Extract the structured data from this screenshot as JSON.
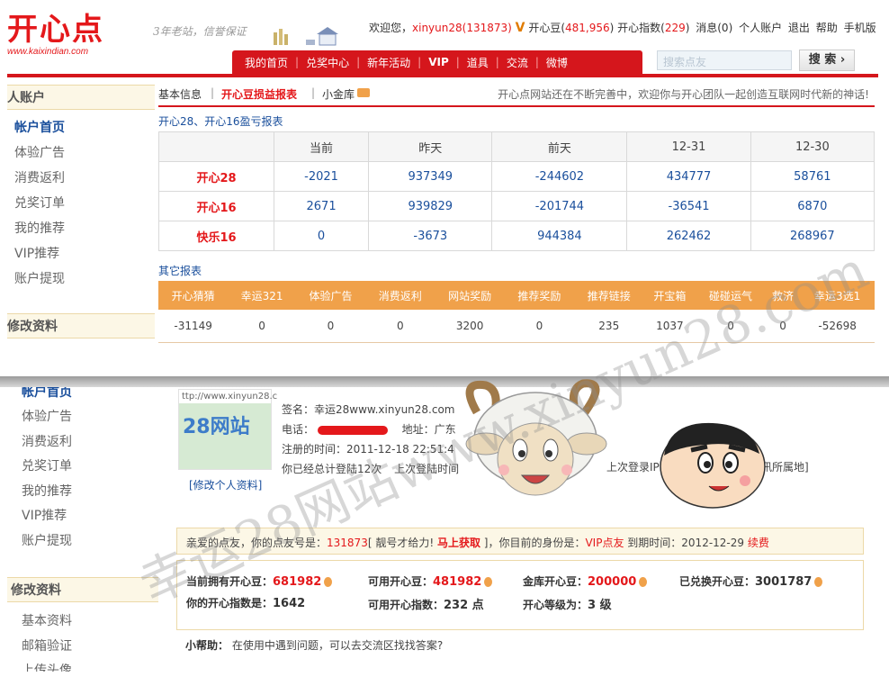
{
  "header": {
    "logo_text": "开心点",
    "logo_url": "www.kaixindian.com",
    "slogan": "3年老站，信誉保证",
    "welcome": "欢迎您，",
    "username": "xinyun28(131873)",
    "vip_mark": "V",
    "beans_label": "开心豆(",
    "beans_value": "481,956",
    "beans_close": ")",
    "index_label": "开心指数(",
    "index_value": "229",
    "index_close": ")",
    "links": [
      "消息(0)",
      "个人账户",
      "退出",
      "帮助",
      "手机版"
    ]
  },
  "nav": {
    "items": [
      "我的首页",
      "兑奖中心",
      "新年活动",
      "VIP",
      "道具",
      "交流",
      "微博"
    ]
  },
  "search": {
    "placeholder": "搜索点友",
    "button": "搜 索 ›"
  },
  "sidebar_top": {
    "heading": "人账户",
    "items": [
      "帐户首页",
      "体验广告",
      "消费返利",
      "兑奖订单",
      "我的推荐",
      "VIP推荐",
      "账户提现"
    ],
    "heading2": "修改资料"
  },
  "tabs": {
    "items": [
      "基本信息",
      "开心豆损益报表",
      "小金库"
    ],
    "notice": "开心点网站还在不断完善中，欢迎你与开心团队一起创造互联网时代新的神话!"
  },
  "report": {
    "title": "开心28、开心16盈亏报表",
    "columns": [
      "",
      "当前",
      "昨天",
      "前天",
      "12-31",
      "12-30"
    ],
    "rows": [
      {
        "name": "开心28",
        "values": [
          "-2021",
          "937349",
          "-244602",
          "434777",
          "58761"
        ]
      },
      {
        "name": "开心16",
        "values": [
          "2671",
          "939829",
          "-201744",
          "-36541",
          "6870"
        ]
      },
      {
        "name": "快乐16",
        "values": [
          "0",
          "-3673",
          "944384",
          "262462",
          "268967"
        ]
      }
    ]
  },
  "other_report": {
    "title": "其它报表",
    "columns": [
      "开心猜猜",
      "幸运321",
      "体验广告",
      "消费返利",
      "网站奖励",
      "推荐奖励",
      "推荐链接",
      "开宝箱",
      "碰碰运气",
      "救济",
      "幸运3选1"
    ],
    "values": [
      "-31149",
      "0",
      "0",
      "0",
      "3200",
      "0",
      "235",
      "1037",
      "0",
      "0",
      "-52698"
    ]
  },
  "sidebar_bottom": {
    "items": [
      "帐户首页",
      "体验广告",
      "消费返利",
      "兑奖订单",
      "我的推荐",
      "VIP推荐",
      "账户提现"
    ],
    "heading": "修改资料",
    "items2": [
      "基本资料",
      "邮箱验证",
      "上传头像"
    ]
  },
  "profile": {
    "avatar_url": "ttp://www.xinyun28.c",
    "avatar_text": "28网站",
    "edit_link": "[修改个人资料]",
    "signature": "签名：幸运28www.xinyun28.com",
    "phone_label": "电话：",
    "address_label": "地址：广东",
    "register_time": "注册的时间：2011-12-18 22:51:4",
    "login_count": "你已经总计登陆12次",
    "last_login_time": "上次登陆时间",
    "last_login_ip": "上次登录IP",
    "last_login_loc": "讯所属地]"
  },
  "status": {
    "greeting": "亲爱的点友，你的点友号是：",
    "user_id": "131873",
    "bracket_open": "[ 靓号才给力! ",
    "get_now": "马上获取",
    "bracket_close": " ]，你目前的身份是：",
    "identity": "VIP点友",
    "expiry_label": " 到期时间：2012-12-29 ",
    "renew": "续费"
  },
  "beans": {
    "current_label": "当前拥有开心豆：",
    "current_value": "681982",
    "available_label": "可用开心豆：",
    "available_value": "481982",
    "vault_label": "金库开心豆：",
    "vault_value": "200000",
    "exchanged_label": "已兑换开心豆：",
    "exchanged_value": "3001787",
    "index_label": "你的开心指数是：",
    "index_value": "1642",
    "avail_index_label": "可用开心指数：",
    "avail_index_value": "232 点",
    "level_label": "开心等级为：",
    "level_value": "3 级"
  },
  "help": {
    "label": "小帮助：",
    "text": "在使用中遇到问题，可以去交流区找找答案?"
  },
  "watermark": {
    "text": "幸运28网站www.xinyun28.com"
  }
}
